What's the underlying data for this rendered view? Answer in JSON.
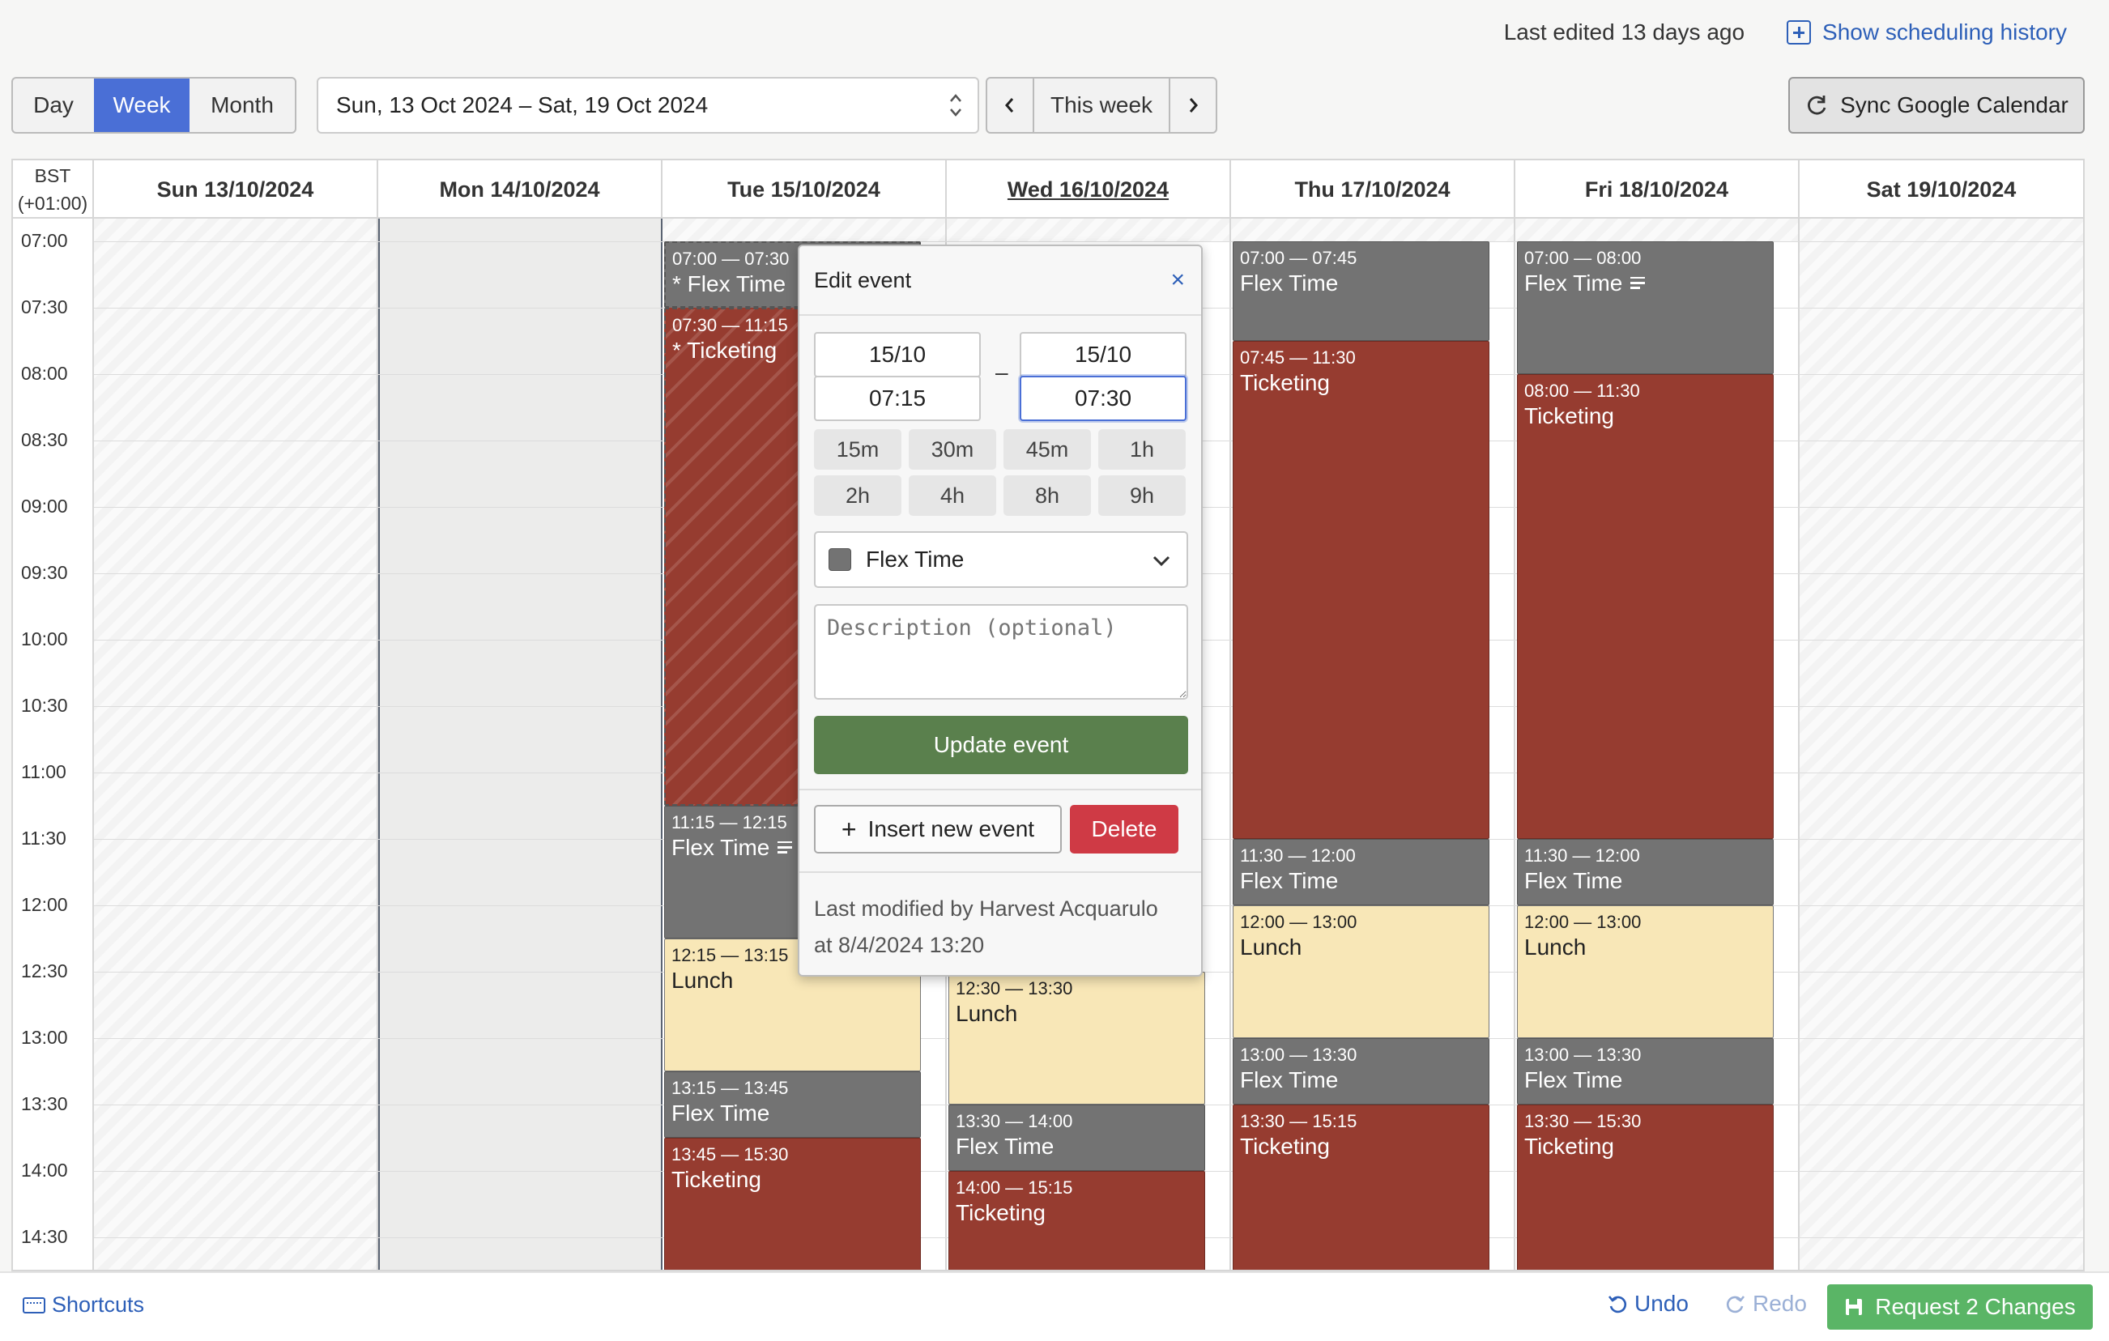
{
  "header": {
    "last_edited": "Last edited 13 days ago",
    "history_label": "Show scheduling history"
  },
  "toolbar": {
    "views": [
      "Day",
      "Week",
      "Month"
    ],
    "active_view": "Week",
    "range_label": "Sun, 13 Oct 2024 – Sat, 19 Oct 2024",
    "this_week_label": "This week",
    "sync_label": "Sync Google Calendar"
  },
  "calendar": {
    "tz_label_1": "BST",
    "tz_label_2": "(+01:00)",
    "days": [
      {
        "label": "Sun 13/10/2024",
        "state": "off"
      },
      {
        "label": "Mon 14/10/2024",
        "state": "monday"
      },
      {
        "label": "Tue 15/10/2024",
        "state": "on"
      },
      {
        "label": "Wed 16/10/2024",
        "state": "on",
        "today": true
      },
      {
        "label": "Thu 17/10/2024",
        "state": "on"
      },
      {
        "label": "Fri 18/10/2024",
        "state": "on"
      },
      {
        "label": "Sat 19/10/2024",
        "state": "off"
      }
    ],
    "time_labels": [
      "07:00",
      "07:30",
      "08:00",
      "08:30",
      "09:00",
      "09:30",
      "10:00",
      "10:30",
      "11:00",
      "11:30",
      "12:00",
      "12:30",
      "13:00",
      "13:30",
      "14:00",
      "14:30"
    ],
    "events": [
      {
        "day": 2,
        "start": "07:00",
        "end": "07:30",
        "time": "07:00 — 07:30",
        "name": "* Flex Time",
        "kind": "flex",
        "dashed": true
      },
      {
        "day": 2,
        "start": "07:30",
        "end": "11:15",
        "time": "07:30 — 11:15",
        "name": "* Ticketing",
        "kind": "tick",
        "hatched": true,
        "dashed": true
      },
      {
        "day": 2,
        "start": "11:15",
        "end": "12:15",
        "time": "11:15 — 12:15",
        "name": "Flex Time",
        "kind": "flex",
        "note": true
      },
      {
        "day": 2,
        "start": "12:15",
        "end": "13:15",
        "time": "12:15 — 13:15",
        "name": "Lunch",
        "kind": "lunch"
      },
      {
        "day": 2,
        "start": "13:15",
        "end": "13:45",
        "time": "13:15 — 13:45",
        "name": "Flex Time",
        "kind": "flex"
      },
      {
        "day": 2,
        "start": "13:45",
        "end": "15:30",
        "time": "13:45 — 15:30",
        "name": "Ticketing",
        "kind": "tick"
      },
      {
        "day": 3,
        "start": "12:30",
        "end": "13:30",
        "time": "12:30 — 13:30",
        "name": "Lunch",
        "kind": "lunch"
      },
      {
        "day": 3,
        "start": "13:30",
        "end": "14:00",
        "time": "13:30 — 14:00",
        "name": "Flex Time",
        "kind": "flex"
      },
      {
        "day": 3,
        "start": "14:00",
        "end": "15:15",
        "time": "14:00 — 15:15",
        "name": "Ticketing",
        "kind": "tick"
      },
      {
        "day": 4,
        "start": "07:00",
        "end": "07:45",
        "time": "07:00 — 07:45",
        "name": "Flex Time",
        "kind": "flex"
      },
      {
        "day": 4,
        "start": "07:45",
        "end": "11:30",
        "time": "07:45 — 11:30",
        "name": "Ticketing",
        "kind": "tick"
      },
      {
        "day": 4,
        "start": "11:30",
        "end": "12:00",
        "time": "11:30 — 12:00",
        "name": "Flex Time",
        "kind": "flex"
      },
      {
        "day": 4,
        "start": "12:00",
        "end": "13:00",
        "time": "12:00 — 13:00",
        "name": "Lunch",
        "kind": "lunch"
      },
      {
        "day": 4,
        "start": "13:00",
        "end": "13:30",
        "time": "13:00 — 13:30",
        "name": "Flex Time",
        "kind": "flex"
      },
      {
        "day": 4,
        "start": "13:30",
        "end": "15:15",
        "time": "13:30 — 15:15",
        "name": "Ticketing",
        "kind": "tick"
      },
      {
        "day": 5,
        "start": "07:00",
        "end": "08:00",
        "time": "07:00 — 08:00",
        "name": "Flex Time",
        "kind": "flex",
        "note": true
      },
      {
        "day": 5,
        "start": "08:00",
        "end": "11:30",
        "time": "08:00 — 11:30",
        "name": "Ticketing",
        "kind": "tick"
      },
      {
        "day": 5,
        "start": "11:30",
        "end": "12:00",
        "time": "11:30 — 12:00",
        "name": "Flex Time",
        "kind": "flex"
      },
      {
        "day": 5,
        "start": "12:00",
        "end": "13:00",
        "time": "12:00 — 13:00",
        "name": "Lunch",
        "kind": "lunch"
      },
      {
        "day": 5,
        "start": "13:00",
        "end": "13:30",
        "time": "13:00 — 13:30",
        "name": "Flex Time",
        "kind": "flex"
      },
      {
        "day": 5,
        "start": "13:30",
        "end": "15:30",
        "time": "13:30 — 15:30",
        "name": "Ticketing",
        "kind": "tick"
      }
    ]
  },
  "popup": {
    "title": "Edit event",
    "close": "×",
    "start_date": "15/10",
    "start_time": "07:15",
    "end_date": "15/10",
    "end_time": "07:30",
    "separator": "–",
    "durations": [
      "15m",
      "30m",
      "45m",
      "1h",
      "2h",
      "4h",
      "8h",
      "9h"
    ],
    "type_label": "Flex Time",
    "type_color": "#737373",
    "description_placeholder": "Description (optional)",
    "update_label": "Update event",
    "insert_label": "Insert new event",
    "delete_label": "Delete",
    "footer_line1": "Last modified by Harvest Acquarulo",
    "footer_line2": "at 8/4/2024 13:20"
  },
  "footer": {
    "shortcuts": "Shortcuts",
    "undo": "Undo",
    "redo": "Redo",
    "request": "Request 2 Changes"
  },
  "colors": {
    "accent": "#4a6fd6",
    "link": "#2d5fb8",
    "flex": "#737373",
    "ticketing": "#963c30",
    "lunch": "#f8e7b7",
    "update": "#5a804d",
    "delete": "#cf3a45",
    "request": "#5ab566"
  }
}
